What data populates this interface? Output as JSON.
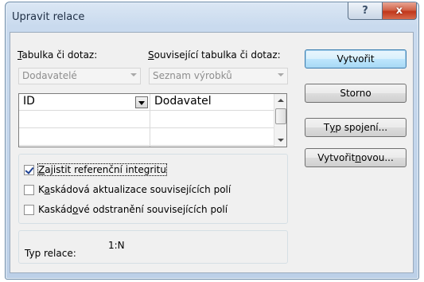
{
  "window": {
    "title": "Upravit relace",
    "help_glyph": "?",
    "close_glyph": "x"
  },
  "left_table": {
    "label_pre": "",
    "label_key": "T",
    "label_post": "abulka či dotaz:",
    "combo_value": "Dodavatelé"
  },
  "right_table": {
    "label_pre": "",
    "label_key": "S",
    "label_post": "ouvisející tabulka či dotaz:",
    "combo_value": "Seznam výrobků"
  },
  "grid": {
    "rows": [
      {
        "left": "ID",
        "right": "Dodavatel"
      },
      {
        "left": "",
        "right": ""
      },
      {
        "left": "",
        "right": ""
      }
    ]
  },
  "options": {
    "referential_integrity": {
      "pre": "",
      "key": "Z",
      "post": "ajistit referenční integritu",
      "checked": true
    },
    "cascade_update": {
      "pre": "K",
      "key": "a",
      "post": "skádová aktualizace souvisejících polí",
      "checked": false
    },
    "cascade_delete": {
      "pre": "Kaskád",
      "key": "o",
      "post": "vé odstranění souvisejících polí",
      "checked": false
    }
  },
  "relation_type": {
    "label": "Typ relace:",
    "value": "1:N"
  },
  "buttons": {
    "create": "Vytvořit",
    "cancel": "Storno",
    "join_type": {
      "pre": "T",
      "key": "y",
      "post": "p spojení..."
    },
    "create_new": {
      "pre": "Vytvořit ",
      "key": "n",
      "post": "ovou..."
    }
  },
  "colors": {
    "window_frame": "#bcd0e8",
    "client_bg": "#f0f0f0",
    "close_button": "#c1361a",
    "default_button_border": "#3c7fb1"
  }
}
